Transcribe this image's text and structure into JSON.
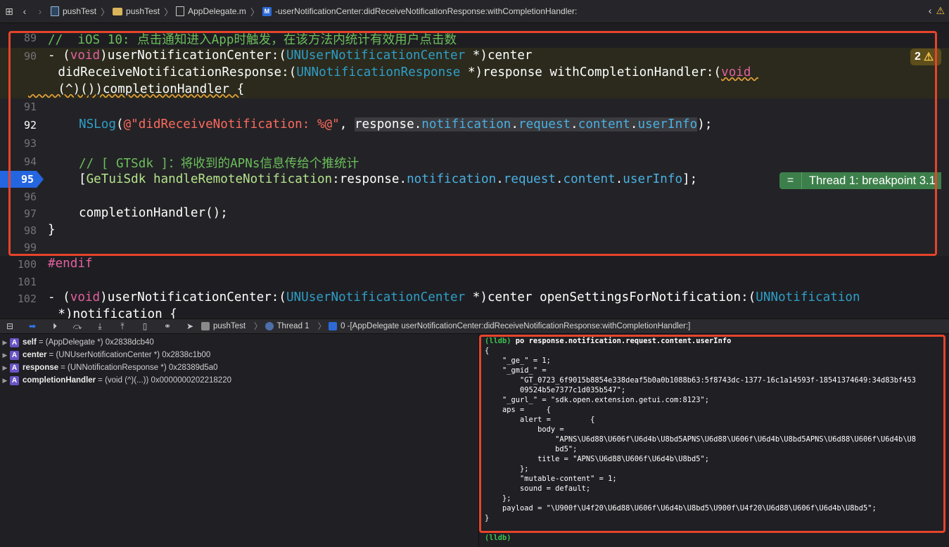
{
  "jumpbar": {
    "project": "pushTest",
    "group": "pushTest",
    "file": "AppDelegate.m",
    "method_badge": "M",
    "method": "-userNotificationCenter:didReceiveNotificationResponse:withCompletionHandler:"
  },
  "editor": {
    "line_numbers": {
      "l89": "89",
      "l90": "90",
      "l91": "91",
      "l92": "92",
      "l93": "93",
      "l94": "94",
      "l95": "95",
      "l96": "96",
      "l97": "97",
      "l98": "98",
      "l99": "99",
      "l100": "100",
      "l101": "101",
      "l102": "102"
    },
    "l89_comment": "//  iOS 10: 点击通知进入App时触发，在该方法内统计有效用户点击数",
    "l90": {
      "p1": "- (",
      "void": "void",
      "p2": ")userNotificationCenter:(",
      "type": "UNUserNotificationCenter",
      "p3": " *)center"
    },
    "l90b": {
      "p1": "    didReceiveNotificationResponse:(",
      "type": "UNNotificationResponse",
      "p2": " *)response withCompletionHandler:(",
      "void": "void "
    },
    "l90c": "    (^)())completionHandler {",
    "l92": {
      "fn": "NSLog",
      "p1": "(",
      "str": "@\"didReceiveNotification: %@\"",
      "p2": ", ",
      "response": "response",
      "dot1": ".",
      "notification": "notification",
      "dot2": ".",
      "request": "request",
      "dot3": ".",
      "content": "content",
      "dot4": ".",
      "userInfo": "userInfo",
      "end": ");"
    },
    "l94_comment": "// [ GTSdk ]：将收到的APNs信息传给个推统计",
    "l95": {
      "open": "[",
      "cls": "GeTuiSdk",
      "sp": " ",
      "msg": "handleRemoteNotification",
      "colon": ":response.",
      "notification": "notification",
      "dot2": ".",
      "request": "request",
      "dot3": ".",
      "content": "content",
      "dot4": ".",
      "userInfo": "userInfo",
      "end": "];"
    },
    "l97": "completionHandler();",
    "l98": "}",
    "l100": "#endif",
    "l102": {
      "p1": "- (",
      "void": "void",
      "p2": ")userNotificationCenter:(",
      "type1": "UNUserNotificationCenter",
      "p3": " *)center openSettingsForNotification:(",
      "type2": "UNNotification"
    },
    "l102b": "    *)notification {",
    "warning_count": "2",
    "thread_label": "Thread 1: breakpoint 3.1",
    "thread_eq": "="
  },
  "debugbar": {
    "project": "pushTest",
    "thread": "Thread 1",
    "frame": "0 -[AppDelegate userNotificationCenter:didReceiveNotificationResponse:withCompletionHandler:]"
  },
  "variables": [
    {
      "name": "self",
      "value": "= (AppDelegate *) 0x2838dcb40"
    },
    {
      "name": "center",
      "value": "= (UNUserNotificationCenter *) 0x2838c1b00"
    },
    {
      "name": "response",
      "value": "= (UNNotificationResponse *) 0x28389d5a0"
    },
    {
      "name": "completionHandler",
      "value": "= (void (^)(...)) 0x0000000202218220"
    }
  ],
  "console": {
    "prompt": "(lldb)",
    "command": " po response.notification.request.content.userInfo",
    "lines": [
      "{",
      "    \"_ge_\" = 1;",
      "    \"_gmid_\" =",
      "        \"GT_0723_6f9015b8854e338deaf5b0a0b1088b63:5f8743dc-1377-16c1a14593f-18541374649:34d83bf453",
      "        09524b5e7377c1d035b547\";",
      "    \"_gurl_\" = \"sdk.open.extension.getui.com:8123\";",
      "    aps =     {",
      "        alert =         {",
      "            body =",
      "                \"APNS\\U6d88\\U606f\\U6d4b\\U8bd5APNS\\U6d88\\U606f\\U6d4b\\U8bd5APNS\\U6d88\\U606f\\U6d4b\\U8",
      "                bd5\";",
      "            title = \"APNS\\U6d88\\U606f\\U6d4b\\U8bd5\";",
      "        };",
      "        \"mutable-content\" = 1;",
      "        sound = default;",
      "    };",
      "    payload = \"\\U900f\\U4f20\\U6d88\\U606f\\U6d4b\\U8bd5\\U900f\\U4f20\\U6d88\\U606f\\U6d4b\\U8bd5\";",
      "}"
    ],
    "last_prompt": "(lldb)"
  }
}
